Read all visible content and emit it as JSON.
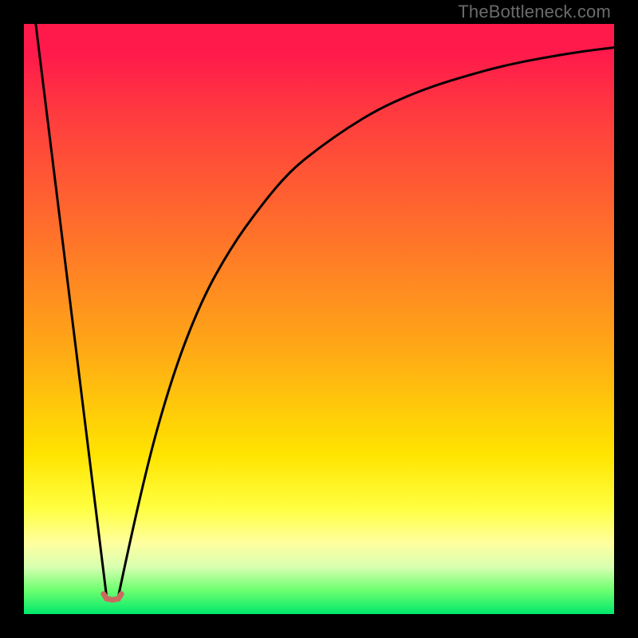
{
  "watermark": "TheBottleneck.com",
  "chart_data": {
    "type": "line",
    "title": "",
    "xlabel": "",
    "ylabel": "",
    "xlim": [
      0,
      100
    ],
    "ylim": [
      0,
      100
    ],
    "grid": false,
    "legend": false,
    "series": [
      {
        "name": "left-segment",
        "x": [
          2,
          14
        ],
        "y": [
          100,
          3
        ]
      },
      {
        "name": "minimum-marker",
        "x": [
          13.5,
          14.0,
          15.0,
          16.0,
          16.5
        ],
        "y": [
          3.4,
          2.6,
          2.4,
          2.6,
          3.4
        ]
      },
      {
        "name": "right-curve",
        "x": [
          16,
          20,
          25,
          30,
          35,
          40,
          45,
          50,
          55,
          60,
          65,
          70,
          75,
          80,
          85,
          90,
          95,
          100
        ],
        "y": [
          3,
          22,
          40,
          53,
          62,
          69,
          75,
          79,
          82.5,
          85.5,
          87.8,
          89.7,
          91.2,
          92.6,
          93.7,
          94.6,
          95.4,
          96
        ]
      }
    ],
    "colors": {
      "curve": "#000000",
      "marker_fill": "#c96a5f",
      "marker_stroke": "#b55248",
      "gradient_top": "#ff1a4b",
      "gradient_bottom": "#00e86b",
      "frame": "#000000"
    }
  }
}
